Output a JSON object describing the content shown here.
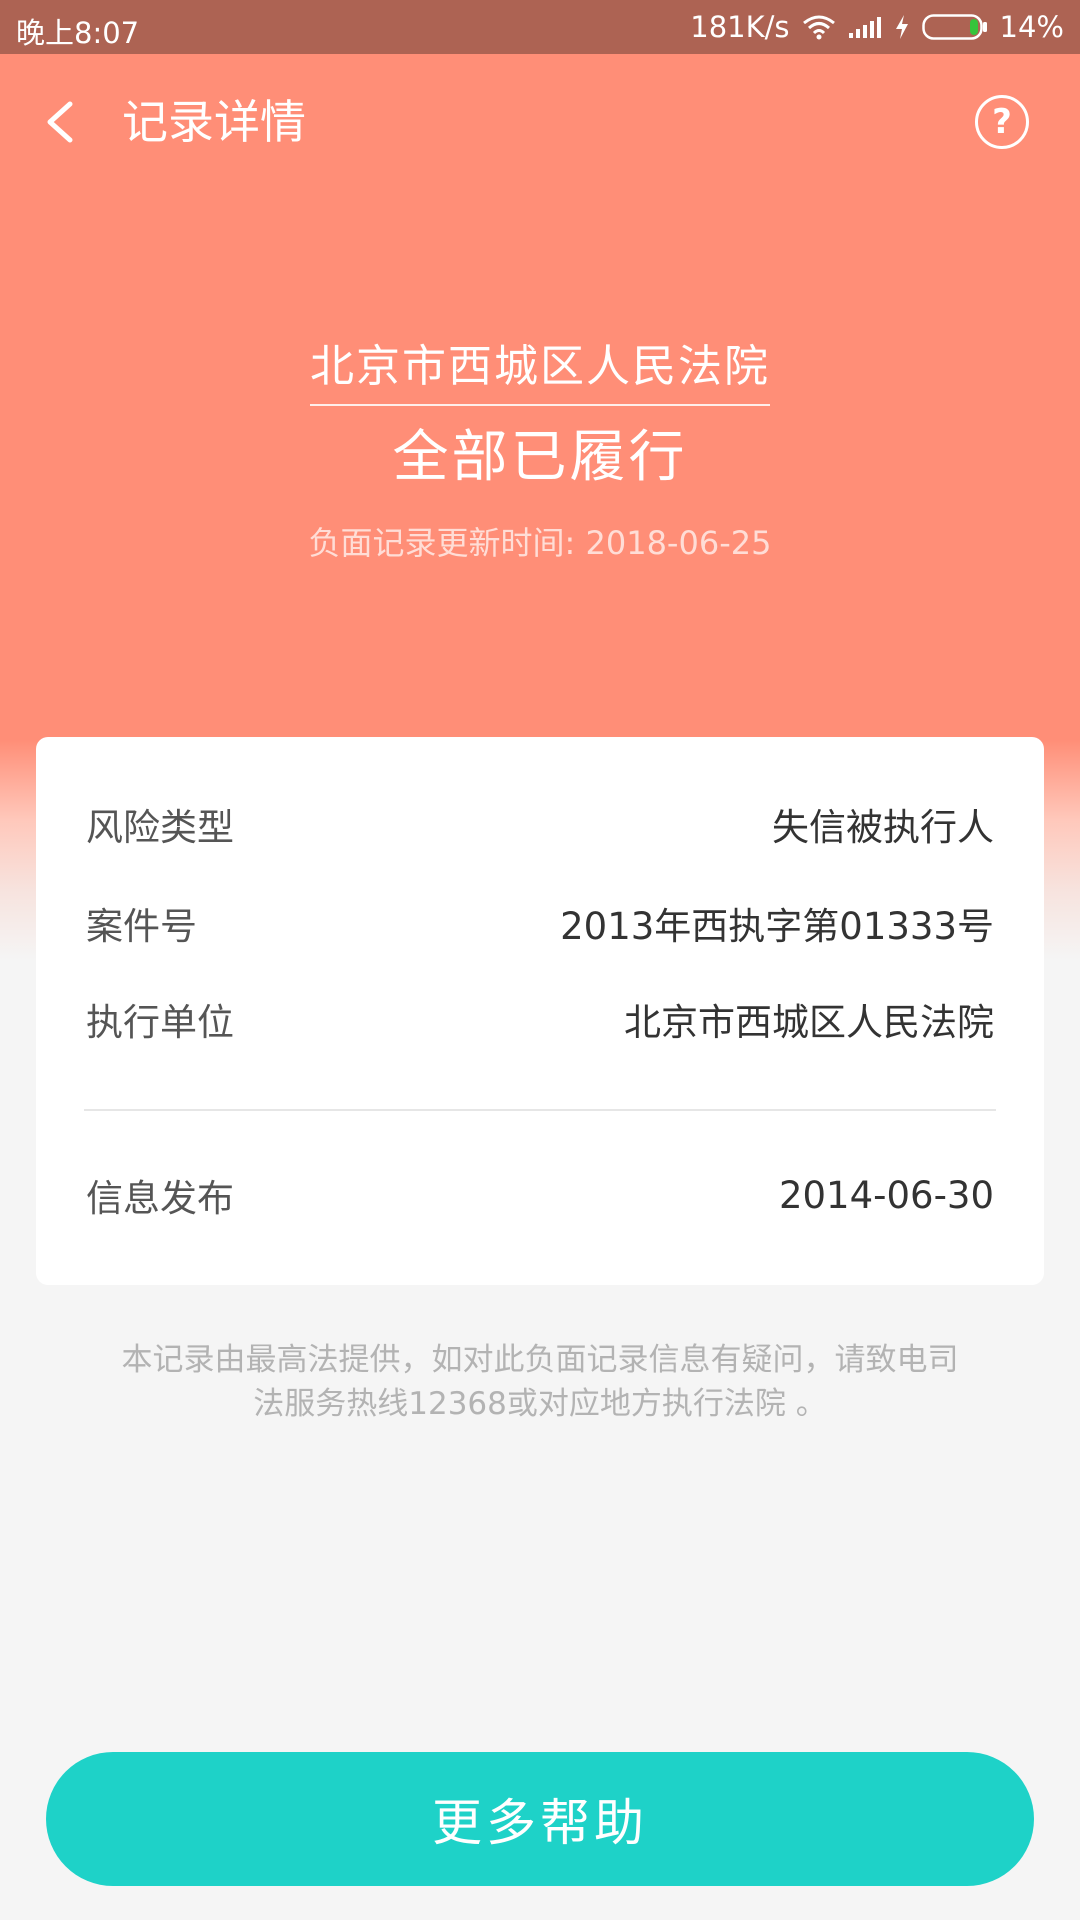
{
  "status_bar": {
    "time": "晚上8:07",
    "net_speed": "181K/s",
    "battery": "14%"
  },
  "nav": {
    "title": "记录详情",
    "help_symbol": "?"
  },
  "hero": {
    "court": "北京市西城区人民法院",
    "status": "全部已履行",
    "updated": "负面记录更新时间: 2018-06-25"
  },
  "details": [
    {
      "label": "风险类型",
      "value": "失信被执行人"
    },
    {
      "label": "案件号",
      "value": "2013年西执字第01333号"
    },
    {
      "label": "执行单位",
      "value": "北京市西城区人民法院"
    },
    {
      "label": "信息发布",
      "value": "2014-06-30"
    }
  ],
  "footnote": "本记录由最高法提供，如对此负面记录信息有疑问，请致电司法服务热线12368或对应地方执行法院 。",
  "more_help_label": "更多帮助",
  "colors": {
    "header": "#ff8e77",
    "status_bar": "#ad6353",
    "button": "#1ed2c8",
    "background": "#f5f5f5"
  },
  "icons": [
    "wifi-icon",
    "signal-icon",
    "charging-icon",
    "battery-icon",
    "back-arrow-icon",
    "help-icon"
  ]
}
